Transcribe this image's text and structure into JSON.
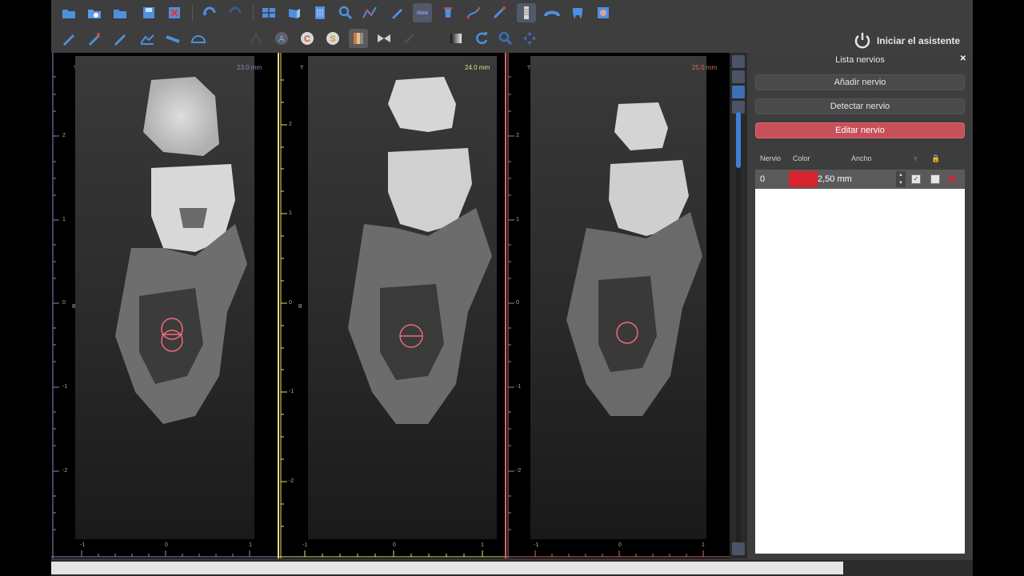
{
  "toolbar": {
    "assistant_label": "Iniciar el asistente"
  },
  "viewer": {
    "panels": [
      {
        "slice_mm": "23.0 mm",
        "accent": "#7f8cc8",
        "top_letter": "T",
        "side_letter": "B",
        "v_ticks": [
          "2",
          "1",
          "0",
          "-1",
          "-2"
        ],
        "h_ticks": [
          "-1",
          "0",
          "1"
        ]
      },
      {
        "slice_mm": "24.0 mm",
        "accent": "#e6e07a",
        "top_letter": "T",
        "side_letter": "B",
        "v_ticks": [
          "2",
          "1",
          "0",
          "-1",
          "-2"
        ],
        "h_ticks": [
          "-1",
          "0",
          "1"
        ]
      },
      {
        "slice_mm": "25.0 mm",
        "accent": "#d06a6a",
        "top_letter": "T",
        "side_letter": "",
        "v_ticks": [
          "2",
          "1",
          "0",
          "-1",
          "-2"
        ],
        "h_ticks": [
          "-1",
          "0",
          "1"
        ]
      }
    ]
  },
  "side_panel": {
    "title": "Lista nervios",
    "close_icon": "close-icon",
    "buttons": {
      "add": "Añadir nervio",
      "detect": "Detectar nervio",
      "edit": "Editar nervio"
    },
    "table": {
      "headers": {
        "nerve": "Nervio",
        "color": "Color",
        "width": "Ancho"
      },
      "rows": [
        {
          "id": "0",
          "color": "#d7232b",
          "width": "2,50 mm",
          "visible_checked": true,
          "locked_checked": false
        }
      ]
    }
  },
  "colors": {
    "accent_red": "#c8505a",
    "nerve_red": "#d7232b"
  }
}
